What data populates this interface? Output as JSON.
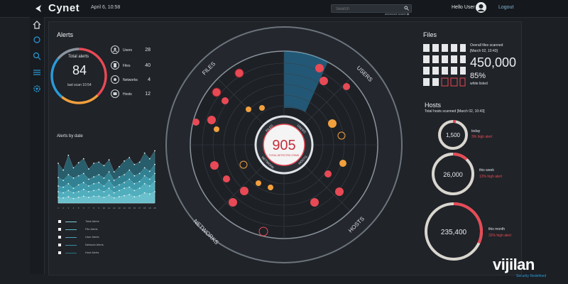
{
  "topbar": {
    "brand": "Cynet",
    "date": "April 6, 10:58",
    "search_placeholder": "Search",
    "advanced": "advanced search ▶",
    "hello": "Hello User",
    "logout": "Logout"
  },
  "alerts": {
    "title": "Alerts",
    "total_label": "Total alerts",
    "total_value": "84",
    "last_scan": "last scan 10:54",
    "rows": [
      {
        "label": "Users",
        "value": "28"
      },
      {
        "label": "Files",
        "value": "40"
      },
      {
        "label": "Networks",
        "value": "4"
      },
      {
        "label": "Hosts",
        "value": "12"
      }
    ]
  },
  "alerts_by_date": {
    "title": "Alerts by date",
    "legend": [
      "Total Alerts",
      "File Alerts",
      "User Alerts",
      "Network Alerts",
      "Host Alerts"
    ]
  },
  "radar": {
    "center_value": "905",
    "center_caption": "TOTAL DETECTED ITEMS",
    "sectors": [
      "FILES",
      "USERS",
      "NETWORKS",
      "HOSTS"
    ],
    "inner_sectors": [
      "FILES",
      "USERS",
      "NETWORK",
      "HOSTS"
    ]
  },
  "files": {
    "title": "Files",
    "overall_label": "Overall files scanned",
    "overall_date": "[March 02, 10:43]",
    "overall_value": "450,000",
    "percent": "85%",
    "percent_caption": "white listed"
  },
  "hosts": {
    "title": "Hosts",
    "scanned_label": "Total hosts scanned [March 02, 10:43]",
    "items": [
      {
        "value": "1,500",
        "period": "today",
        "alert": "3% high alert"
      },
      {
        "value": "26,000",
        "period": "this week",
        "alert": "12% high alert"
      },
      {
        "value": "235,400",
        "period": "this month",
        "alert": "32% high alert"
      }
    ]
  },
  "watermark": {
    "brand": "vijilan",
    "tagline": "Security Redefined"
  },
  "chart_data": {
    "type": "area",
    "title": "Alerts by date",
    "x": [
      "1",
      "2",
      "3",
      "4",
      "5",
      "6",
      "7",
      "8",
      "9",
      "10",
      "11",
      "12",
      "13",
      "14",
      "15",
      "16",
      "17",
      "18",
      "19",
      "20"
    ],
    "series": [
      {
        "name": "Total Alerts",
        "values": [
          70,
          58,
          84,
          62,
          71,
          78,
          60,
          70,
          72,
          66,
          76,
          55,
          64,
          74,
          80,
          68,
          72,
          88,
          78,
          92
        ]
      },
      {
        "name": "File Alerts",
        "values": [
          45,
          40,
          50,
          44,
          48,
          52,
          42,
          46,
          50,
          44,
          55,
          40,
          46,
          50,
          58,
          48,
          52,
          62,
          56,
          68
        ]
      },
      {
        "name": "User Alerts",
        "values": [
          30,
          28,
          34,
          26,
          32,
          36,
          30,
          34,
          36,
          30,
          40,
          28,
          32,
          36,
          42,
          34,
          38,
          48,
          42,
          52
        ]
      },
      {
        "name": "Network Alerts",
        "values": [
          20,
          18,
          22,
          18,
          20,
          24,
          20,
          22,
          24,
          20,
          26,
          18,
          22,
          26,
          28,
          22,
          26,
          34,
          30,
          38
        ]
      },
      {
        "name": "Host Alerts",
        "values": [
          10,
          9,
          11,
          8,
          10,
          12,
          10,
          12,
          12,
          10,
          14,
          9,
          11,
          13,
          15,
          11,
          13,
          18,
          16,
          20
        ]
      }
    ],
    "ylim": [
      0,
      100
    ]
  }
}
